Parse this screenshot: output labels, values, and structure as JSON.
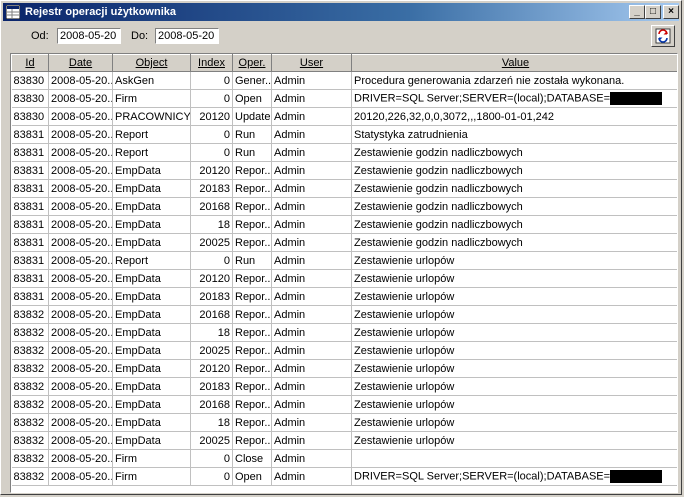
{
  "window": {
    "title": "Rejestr operacji użytkownika"
  },
  "title_buttons": {
    "minimize": "_",
    "maximize": "□",
    "close": "×"
  },
  "filter": {
    "from_label": "Od:",
    "from_value": "2008-05-20",
    "to_label": "Do:",
    "to_value": "2008-05-20"
  },
  "columns": [
    "Id",
    "Date",
    "Object",
    "Index",
    "Oper.",
    "User",
    "Value"
  ],
  "rows": [
    [
      "83830",
      "2008-05-20...",
      "AskGen",
      "0",
      "Gener...",
      "Admin",
      "Procedura generowania zdarzeń nie została wykonana."
    ],
    [
      "83830",
      "2008-05-20...",
      "Firm",
      "0",
      "Open",
      "Admin",
      "DRIVER=SQL Server;SERVER=(local);DATABASE="
    ],
    [
      "83830",
      "2008-05-20...",
      "PRACOWNICY",
      "20120",
      "Update",
      "Admin",
      "20120,226,32,0,0,3072,,,1800-01-01,242"
    ],
    [
      "83831",
      "2008-05-20...",
      "Report",
      "0",
      "Run",
      "Admin",
      "Statystyka zatrudnienia"
    ],
    [
      "83831",
      "2008-05-20...",
      "Report",
      "0",
      "Run",
      "Admin",
      "Zestawienie godzin nadliczbowych"
    ],
    [
      "83831",
      "2008-05-20...",
      "EmpData",
      "20120",
      "Repor...",
      "Admin",
      "Zestawienie godzin nadliczbowych"
    ],
    [
      "83831",
      "2008-05-20...",
      "EmpData",
      "20183",
      "Repor...",
      "Admin",
      "Zestawienie godzin nadliczbowych"
    ],
    [
      "83831",
      "2008-05-20...",
      "EmpData",
      "20168",
      "Repor...",
      "Admin",
      "Zestawienie godzin nadliczbowych"
    ],
    [
      "83831",
      "2008-05-20...",
      "EmpData",
      "18",
      "Repor...",
      "Admin",
      "Zestawienie godzin nadliczbowych"
    ],
    [
      "83831",
      "2008-05-20...",
      "EmpData",
      "20025",
      "Repor...",
      "Admin",
      "Zestawienie godzin nadliczbowych"
    ],
    [
      "83831",
      "2008-05-20...",
      "Report",
      "0",
      "Run",
      "Admin",
      "Zestawienie urlopów"
    ],
    [
      "83831",
      "2008-05-20...",
      "EmpData",
      "20120",
      "Repor...",
      "Admin",
      "Zestawienie urlopów"
    ],
    [
      "83831",
      "2008-05-20...",
      "EmpData",
      "20183",
      "Repor...",
      "Admin",
      "Zestawienie urlopów"
    ],
    [
      "83832",
      "2008-05-20...",
      "EmpData",
      "20168",
      "Repor...",
      "Admin",
      "Zestawienie urlopów"
    ],
    [
      "83832",
      "2008-05-20...",
      "EmpData",
      "18",
      "Repor...",
      "Admin",
      "Zestawienie urlopów"
    ],
    [
      "83832",
      "2008-05-20...",
      "EmpData",
      "20025",
      "Repor...",
      "Admin",
      "Zestawienie urlopów"
    ],
    [
      "83832",
      "2008-05-20...",
      "EmpData",
      "20120",
      "Repor...",
      "Admin",
      "Zestawienie urlopów"
    ],
    [
      "83832",
      "2008-05-20...",
      "EmpData",
      "20183",
      "Repor...",
      "Admin",
      "Zestawienie urlopów"
    ],
    [
      "83832",
      "2008-05-20...",
      "EmpData",
      "20168",
      "Repor...",
      "Admin",
      "Zestawienie urlopów"
    ],
    [
      "83832",
      "2008-05-20...",
      "EmpData",
      "18",
      "Repor...",
      "Admin",
      "Zestawienie urlopów"
    ],
    [
      "83832",
      "2008-05-20...",
      "EmpData",
      "20025",
      "Repor...",
      "Admin",
      "Zestawienie urlopów"
    ],
    [
      "83832",
      "2008-05-20...",
      "Firm",
      "0",
      "Close",
      "Admin",
      ""
    ],
    [
      "83832",
      "2008-05-20...",
      "Firm",
      "0",
      "Open",
      "Admin",
      "DRIVER=SQL Server;SERVER=(local);DATABASE="
    ]
  ],
  "redacted_rows": [
    1,
    22
  ],
  "icons": {
    "app": "grid-app-icon",
    "refresh": "refresh-icon"
  },
  "colors": {
    "title_start": "#0a246a",
    "title_end": "#a6caf0",
    "face": "#d4d0c8"
  }
}
